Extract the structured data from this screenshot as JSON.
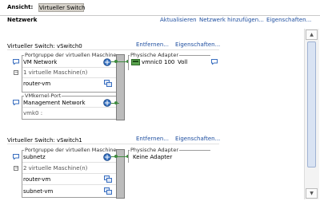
{
  "header": {
    "view_label": "Ansicht:",
    "view_value": "Virtueller Switch",
    "section": "Netzwerk",
    "actions": {
      "refresh": "Aktualisieren",
      "add_network": "Netzwerk hinzufügen...",
      "properties": "Eigenschaften..."
    }
  },
  "switches": [
    {
      "title": "Virtueller Switch: vSwitch0",
      "remove": "Entfernen...",
      "properties": "Eigenschaften...",
      "portgroup_title": "Portgruppe der virtuellen Maschine",
      "portgroup_name": "VM Network",
      "vm_count": "1 virtuelle Maschine(n)",
      "vms": [
        "router-vm"
      ],
      "vmkernel_title": "VMkernel-Port",
      "vmkernel_name": "Management Network",
      "vmkernel_ip": "vmk0 :",
      "adapters_title": "Physische Adapter",
      "adapter": {
        "name": "vmnic0",
        "speed": "100",
        "duplex": "Voll"
      }
    },
    {
      "title": "Virtueller Switch: vSwitch1",
      "remove": "Entfernen...",
      "properties": "Eigenschaften...",
      "portgroup_title": "Portgruppe der virtuellen Maschine",
      "portgroup_name": "subnetz",
      "vm_count": "2 virtuelle Maschine(n)",
      "vms": [
        "router-vm",
        "subnet-vm"
      ],
      "adapters_title": "Physische Adapter",
      "no_adapter": "Keine Adapter"
    }
  ],
  "colors": {
    "link": "#1f4fa0",
    "line": "#3d8a3d",
    "bar": "#bcbcbc"
  },
  "icons": [
    "portgroup-icon",
    "vm-icon",
    "nic-icon",
    "speech-bubble-icon"
  ]
}
